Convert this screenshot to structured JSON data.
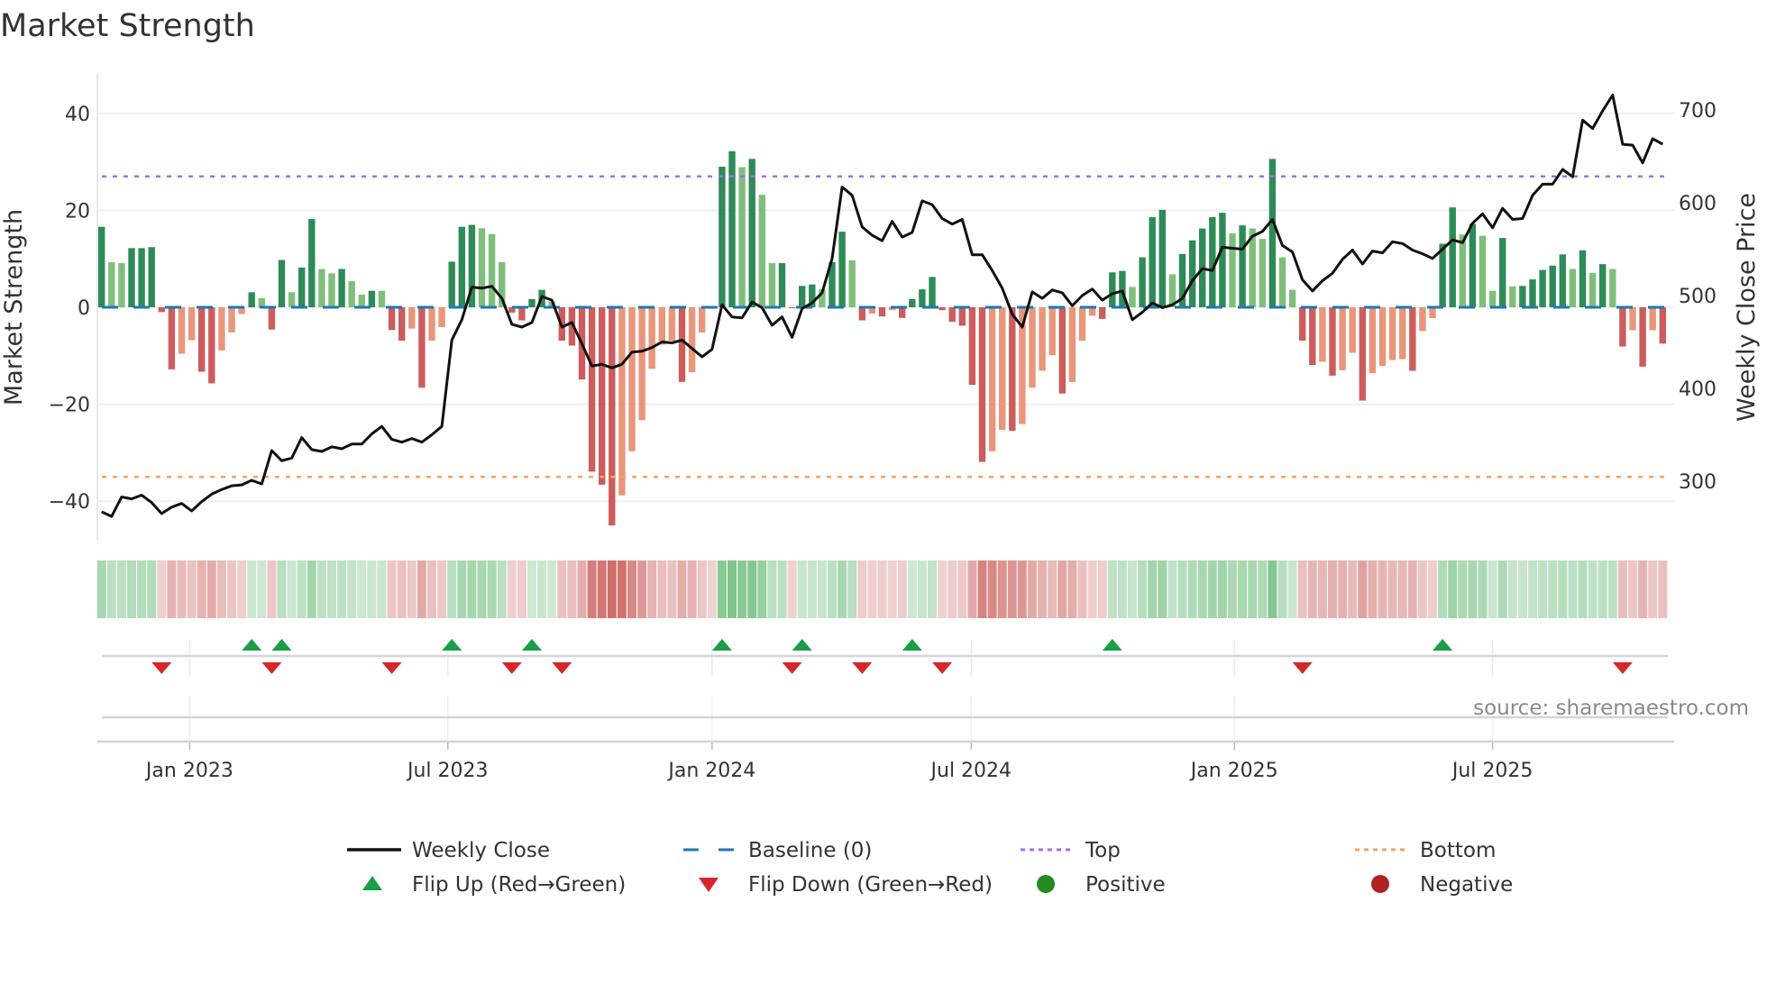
{
  "chart_data": {
    "type": "bar",
    "title": "Market Strength",
    "ylabel": "Market Strength",
    "y2label": "Weekly Close Price",
    "ylim": [
      -48,
      48
    ],
    "y2lim": [
      255,
      725
    ],
    "grid": true,
    "legend_position": "bottom",
    "source": "source: sharemaestro.com",
    "left_ticks": [
      {
        "v": 40,
        "label": "40"
      },
      {
        "v": 20,
        "label": "20"
      },
      {
        "v": 0,
        "label": "0"
      },
      {
        "v": -20,
        "label": "−20"
      },
      {
        "v": -40,
        "label": "−40"
      }
    ],
    "right_ticks": [
      {
        "v": 700,
        "label": "700"
      },
      {
        "v": 600,
        "label": "600"
      },
      {
        "v": 500,
        "label": "500"
      },
      {
        "v": 400,
        "label": "400"
      },
      {
        "v": 300,
        "label": "300"
      }
    ],
    "x_ticks": [
      {
        "week": 9.8,
        "label": "Jan 2023"
      },
      {
        "week": 35.6,
        "label": "Jul 2023"
      },
      {
        "week": 62.0,
        "label": "Jan 2024"
      },
      {
        "week": 87.9,
        "label": "Jul 2024"
      },
      {
        "week": 114.2,
        "label": "Jan 2025"
      },
      {
        "week": 140.0,
        "label": "Jul 2025"
      }
    ],
    "reference_lines": {
      "top": 27,
      "bottom": -35,
      "baseline": 0
    },
    "strength": [
      16.6,
      9.3,
      9.1,
      12.2,
      12.2,
      12.4,
      -1,
      -12.8,
      -9.6,
      -6.8,
      -13.3,
      -15.7,
      -8.9,
      -5.2,
      -1.4,
      3.1,
      1.9,
      -4.6,
      9.75,
      3.1,
      8.2,
      18.2,
      7.9,
      7.0,
      7.9,
      5.4,
      2.6,
      3.4,
      3.4,
      -4.7,
      -6.9,
      -4.4,
      -16.6,
      -6.9,
      -4.1,
      9.4,
      16.6,
      17.0,
      16.3,
      15.1,
      9.3,
      -1.1,
      -2.7,
      1.7,
      3.6,
      1.2,
      -6.9,
      -7.9,
      -14.9,
      -33.9,
      -36.6,
      -45,
      -38.8,
      -29.7,
      -23.3,
      -12.7,
      -7.7,
      -6.9,
      -15.4,
      -13.4,
      -5.2,
      -0.3,
      29,
      32.2,
      28.9,
      30.6,
      23.2,
      9.1,
      9.1,
      -0.2,
      4.4,
      4.7,
      3.7,
      9.3,
      15.6,
      9.7,
      -2.7,
      -1.3,
      -1.9,
      -0.6,
      -2.2,
      1.7,
      3.7,
      6.25,
      -0.6,
      -3,
      -3.8,
      -16,
      -31.9,
      -29.7,
      -25.3,
      -25.5,
      -24.1,
      -16.6,
      -13.1,
      -9.9,
      -17.8,
      -15.4,
      -6.9,
      -1.75,
      -2.4,
      7.2,
      7.5,
      4.2,
      10.3,
      18.6,
      20.1,
      6.8,
      11,
      13.8,
      16.25,
      18.6,
      19.5,
      15.25,
      16.9,
      16.25,
      14.1,
      30.6,
      10.3,
      3.6,
      -6.9,
      -11.9,
      -11.25,
      -14.1,
      -13,
      -9.4,
      -19.25,
      -13.6,
      -12.1,
      -10.9,
      -10.7,
      -13.1,
      -4.9,
      -2.25,
      13.1,
      20.6,
      15,
      17.2,
      14.75,
      3.4,
      14.3,
      4.3,
      4.4,
      5.75,
      7.7,
      8.6,
      10.9,
      7.9,
      11.75,
      7.1,
      8.9,
      7.9,
      -8.1,
      -4.75,
      -12.25,
      -4.75,
      -7.5
    ],
    "strong": [
      1,
      0,
      0,
      1,
      1,
      1,
      1,
      1,
      0,
      0,
      1,
      1,
      0,
      0,
      0,
      1,
      0,
      1,
      1,
      0,
      1,
      1,
      0,
      0,
      1,
      0,
      0,
      1,
      0,
      1,
      1,
      0,
      1,
      0,
      0,
      1,
      1,
      1,
      0,
      0,
      0,
      1,
      1,
      1,
      1,
      0,
      1,
      1,
      1,
      1,
      1,
      1,
      0,
      0,
      0,
      0,
      0,
      0,
      1,
      0,
      0,
      1,
      1,
      1,
      0,
      1,
      0,
      0,
      1,
      1,
      1,
      1,
      0,
      1,
      1,
      0,
      1,
      0,
      1,
      0,
      1,
      1,
      1,
      1,
      1,
      1,
      1,
      1,
      1,
      0,
      0,
      1,
      0,
      0,
      0,
      0,
      1,
      0,
      0,
      0,
      1,
      1,
      1,
      0,
      1,
      1,
      1,
      0,
      1,
      1,
      1,
      1,
      1,
      0,
      1,
      0,
      0,
      1,
      0,
      0,
      1,
      1,
      0,
      1,
      0,
      0,
      1,
      0,
      0,
      0,
      0,
      1,
      0,
      0,
      1,
      1,
      0,
      1,
      0,
      0,
      1,
      0,
      1,
      1,
      1,
      1,
      1,
      0,
      1,
      0,
      1,
      0,
      1,
      0,
      1,
      0,
      1
    ],
    "weekly_close": [
      267,
      262,
      283,
      281,
      285,
      277,
      265,
      272,
      276,
      268,
      278,
      286,
      291,
      295,
      296,
      301,
      297,
      333,
      322,
      325,
      347,
      334,
      332,
      337,
      335,
      340,
      340,
      351,
      359,
      345,
      342,
      346,
      342,
      350,
      359,
      452,
      474,
      509,
      508,
      510,
      497,
      469,
      466,
      471,
      499,
      495,
      466,
      471,
      448,
      424,
      426,
      422,
      426,
      439,
      440,
      444,
      450,
      449,
      452,
      443,
      434,
      442,
      490,
      477,
      476,
      493,
      487,
      468,
      477,
      455,
      486,
      492,
      503,
      540,
      617,
      608,
      574,
      565,
      559,
      580,
      563,
      568,
      602,
      598,
      583,
      577,
      582,
      544,
      544,
      527,
      508,
      480,
      466,
      504,
      497,
      506,
      503,
      489,
      500,
      507,
      495,
      502,
      505,
      474,
      482,
      492,
      487,
      490,
      497,
      516,
      529,
      527,
      552,
      551,
      550,
      564,
      569,
      582,
      554,
      547,
      517,
      505,
      516,
      524,
      539,
      549,
      534,
      548,
      546,
      558,
      556,
      549,
      545,
      540,
      550,
      560,
      557,
      578,
      588,
      573,
      594,
      582,
      583,
      608,
      620,
      620,
      636,
      628,
      689,
      680,
      699,
      716,
      663,
      662,
      643,
      669,
      663
    ],
    "flip_up_weeks": [
      16,
      19,
      36,
      44,
      63,
      71,
      82,
      102,
      135
    ],
    "flip_down_weeks": [
      7,
      18,
      30,
      42,
      47,
      70,
      77,
      85,
      121,
      153
    ],
    "colors": {
      "strong_pos": "#2e8b57",
      "weak_pos": "#7fbf7b",
      "strong_neg": "#cd5c5c",
      "weak_neg": "#e9967a",
      "close": "#111111",
      "baseline": "#1f77b4",
      "top": "#a66cf0",
      "bottom": "#f4a261",
      "flip_up": "#1a9e47",
      "flip_down": "#d62728",
      "positive": "#228b22",
      "negative": "#b22222"
    },
    "legend": [
      {
        "key": "close",
        "label": "Weekly Close"
      },
      {
        "key": "baseline",
        "label": "Baseline (0)"
      },
      {
        "key": "top",
        "label": "Top"
      },
      {
        "key": "bottom",
        "label": "Bottom"
      },
      {
        "key": "flip_up",
        "label": "Flip Up (Red→Green)"
      },
      {
        "key": "flip_down",
        "label": "Flip Down (Green→Red)"
      },
      {
        "key": "positive",
        "label": "Positive"
      },
      {
        "key": "negative",
        "label": "Negative"
      }
    ]
  }
}
